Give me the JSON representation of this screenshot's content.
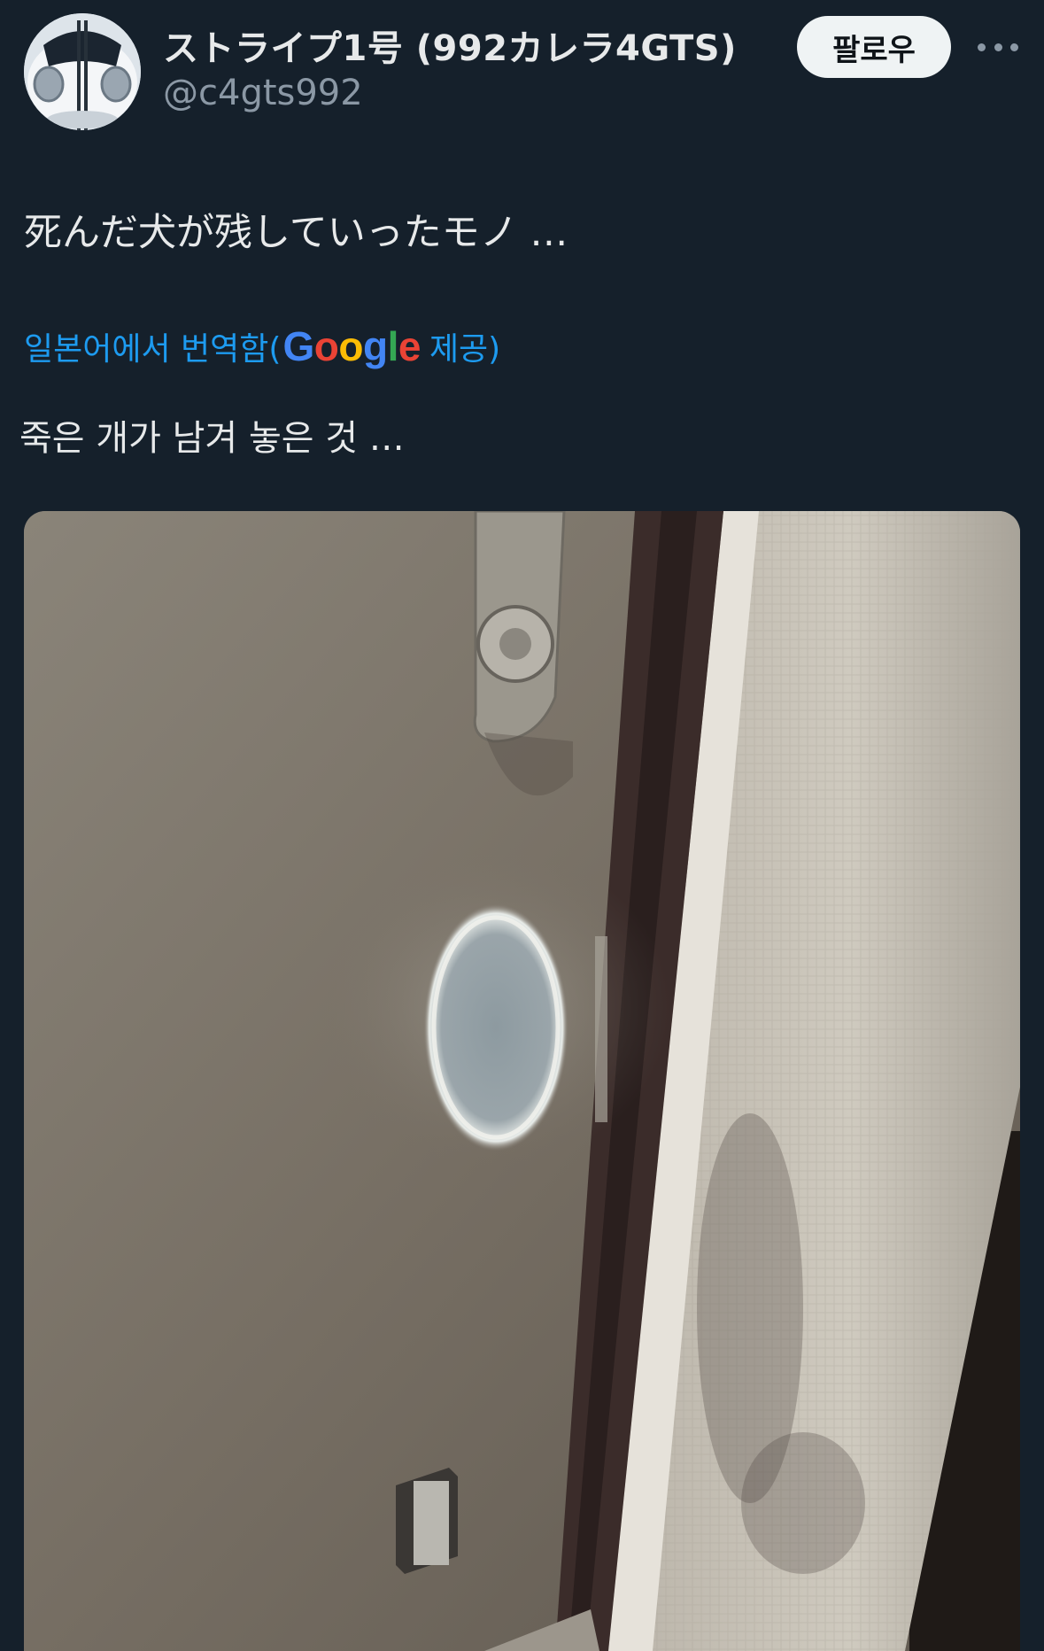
{
  "tweet": {
    "display_name": "ストライプ1号 (992カレラ4GTS)",
    "handle": "@c4gts992",
    "follow_label": "팔로우",
    "text": "死んだ犬が残していったモノ …",
    "translate": {
      "prefix": "일본어에서 번역함(",
      "logo_letters": [
        "G",
        "o",
        "o",
        "g",
        "l",
        "e"
      ],
      "suffix": " 제공)"
    },
    "translated_text": "죽은 개가 남겨 놓은 것 …"
  },
  "icons": {
    "more": "more-dots-icon",
    "avatar": "car-avatar"
  },
  "colors": {
    "background": "#15202b",
    "link": "#1d9bf0",
    "follow_bg": "#eff3f4",
    "secondary_text": "#8b98a5"
  }
}
